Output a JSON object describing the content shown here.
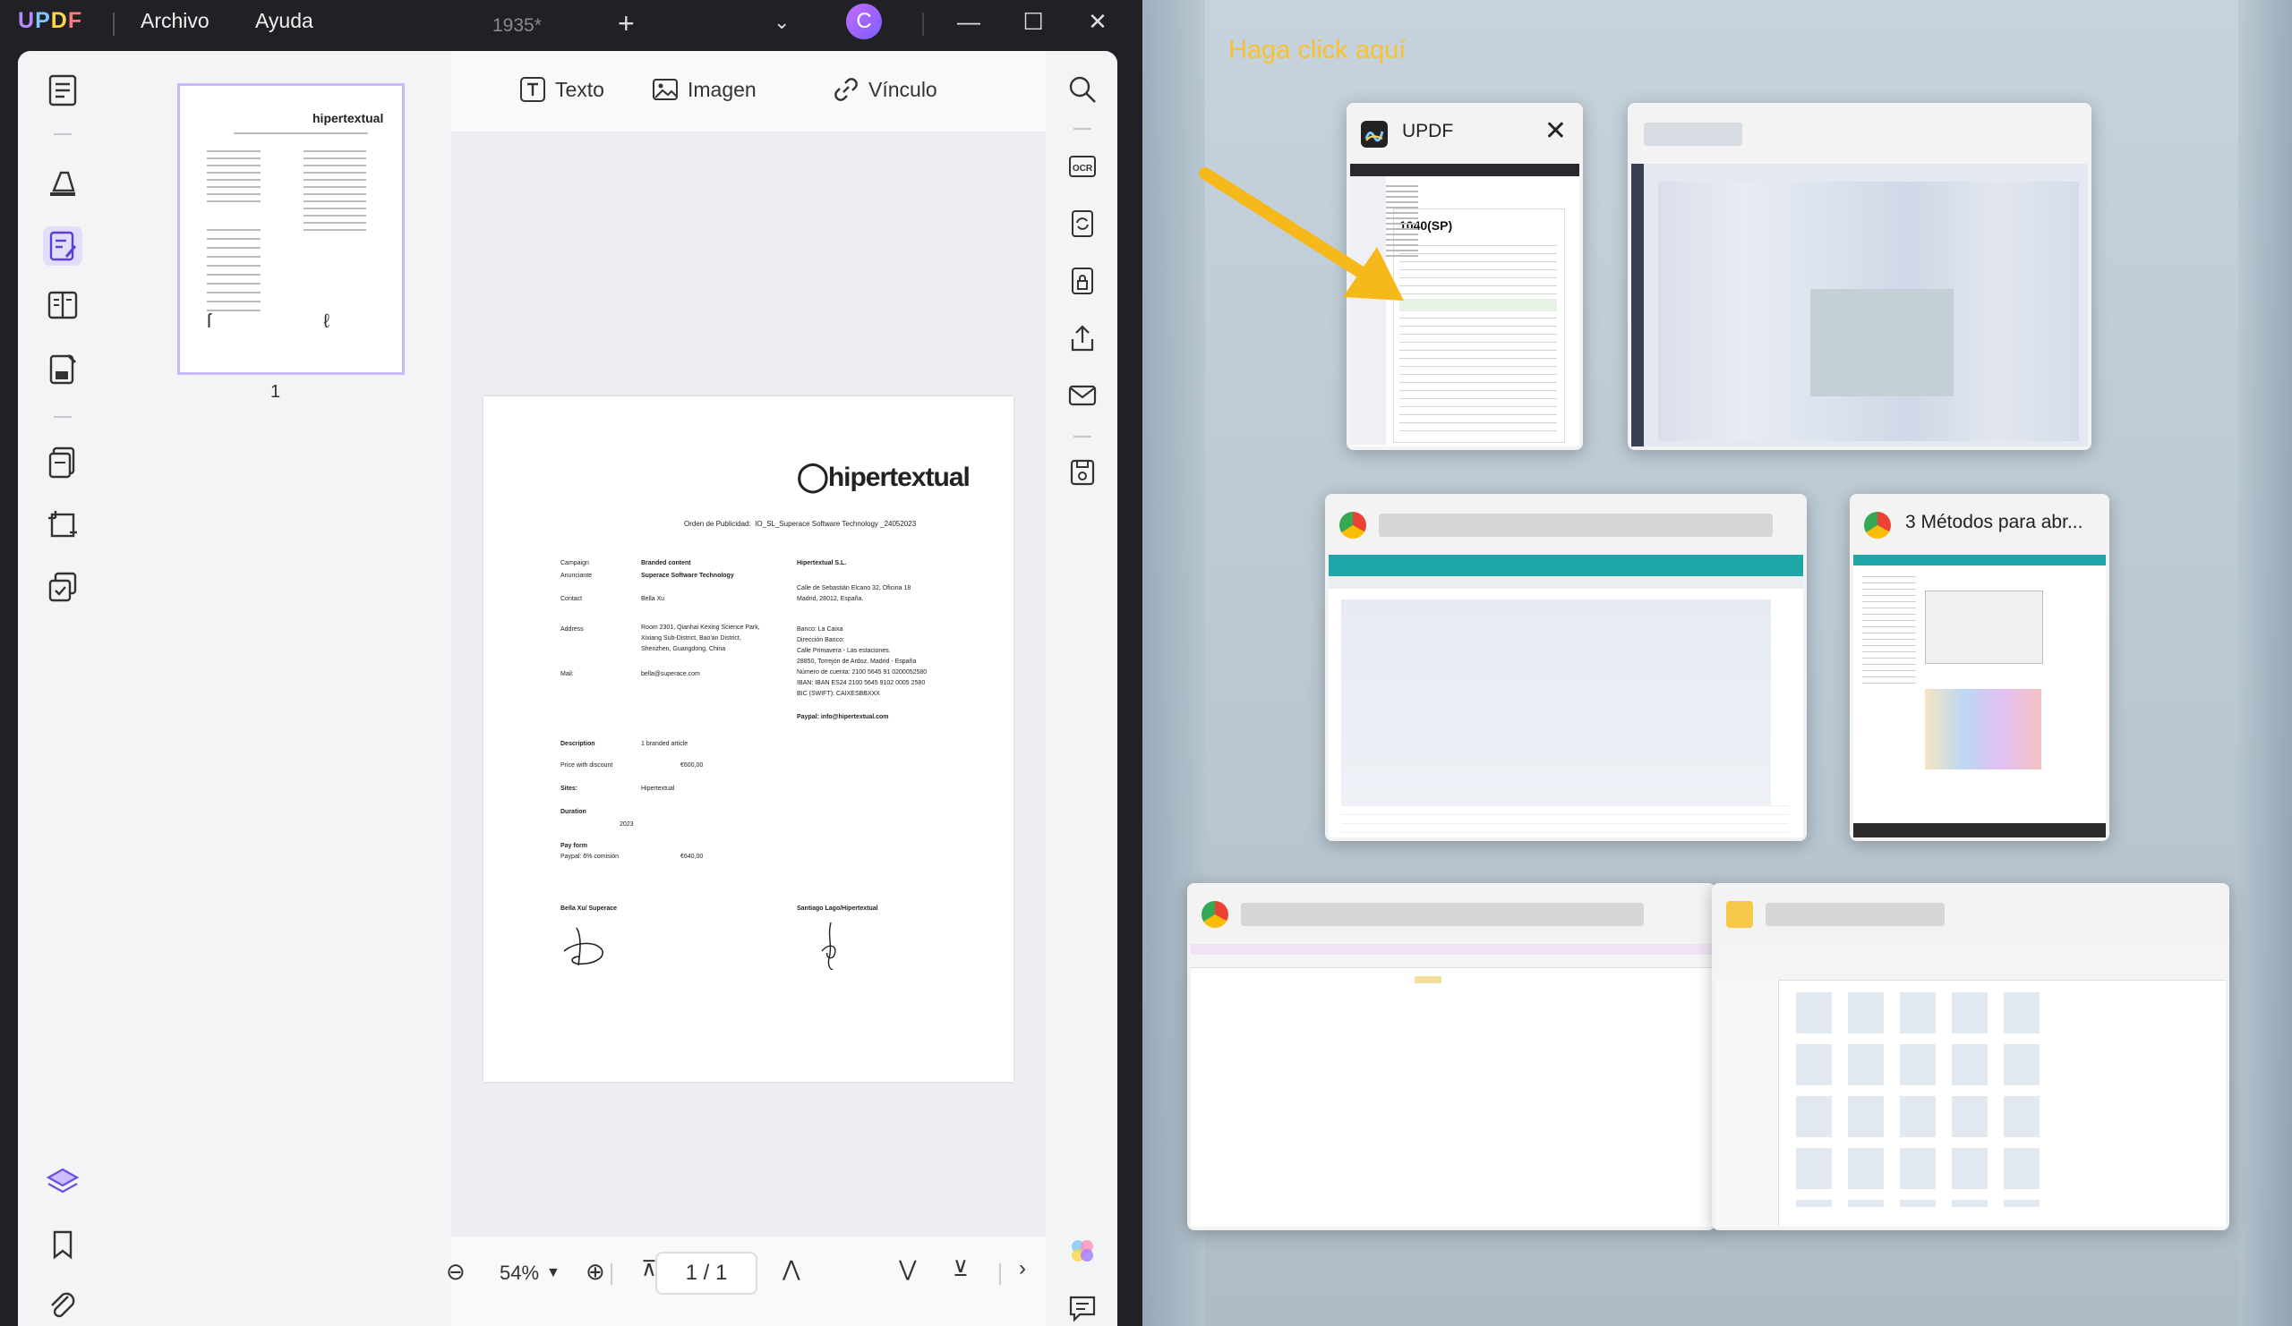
{
  "titlebar": {
    "logo": "UPDF",
    "menu_file": "Archivo",
    "menu_help": "Ayuda",
    "doc_tab": "1935*",
    "avatar_letter": "C"
  },
  "toolbar": {
    "text_label": "Texto",
    "image_label": "Imagen",
    "link_label": "Vínculo"
  },
  "thumbs": {
    "page_number": "1"
  },
  "bottombar": {
    "zoom": "54%",
    "page_indicator": "1 / 1"
  },
  "document": {
    "brand": "hipertextual",
    "order_title": "Orden de Publicidad:",
    "order_id": "IO_SL_Superace Software Technology _24052023",
    "rows": [
      {
        "label": "Campaign",
        "value": "Branded content",
        "bold_value": true,
        "right": "Hipertextual S.L.",
        "right_bold": true
      },
      {
        "label": "Anunciante",
        "value": "Superace Software Technology",
        "bold_value": true,
        "right": "",
        "right_bold": false
      },
      {
        "label": "Contact",
        "value": "Bella Xu",
        "bold_value": false,
        "right": "",
        "right_bold": false
      }
    ],
    "right_address": [
      "Calle de Sebastián Elcano 32, Oficina 18",
      "Madrid, 28012, España."
    ],
    "address_label": "Address",
    "address": [
      "Room 2301, Qianhai Kexing Science Park,",
      "Xixiang Sub-District, Bao'an District,",
      "Shenzhen, Guangdong, China"
    ],
    "bank": [
      "Banco: La Caixa",
      "Dirección Banco:",
      "Calle Primavera - Las estaciones.",
      "28850, Torrejón de Ardoz. Madrid - España",
      "Número de cuenta: 2100 5645 91 0200052580",
      "IBAN: IBAN ES24 2100 5645 9102 0005 2580",
      "BIC (SWIFT): CAIXESBBXXX"
    ],
    "mail_label": "Mail:",
    "mail": "bella@superace.com",
    "paypal": "Paypal: info@hipertextual.com",
    "description_label": "Description",
    "description": "1 branded article",
    "price_label": "Price with discount",
    "price": "€600,00",
    "sites_label": "Sites:",
    "sites": "Hipertextual",
    "duration_label": "Duration",
    "duration": "2023",
    "payform_label": "Pay form",
    "payform": "Paypal: 6% comisión",
    "payform_amount": "€640,00",
    "sig_left": "Bella Xu/ Superace",
    "sig_right": "Santiago Lago/Hipertextual"
  },
  "switcher": {
    "hint": "Haga click aquí",
    "windows": [
      {
        "title": "UPDF",
        "app": "updf"
      },
      {
        "title": "",
        "app": "blurred"
      },
      {
        "title": "",
        "app": "chrome"
      },
      {
        "title": "3 Métodos para abr...",
        "app": "chrome"
      },
      {
        "title": "",
        "app": "chrome"
      },
      {
        "title": "",
        "app": "explorer"
      }
    ]
  },
  "colors": {
    "accent_purple": "#7b5cff",
    "hint_yellow": "#f7c12f",
    "arrow_yellow": "#f5b91c"
  }
}
